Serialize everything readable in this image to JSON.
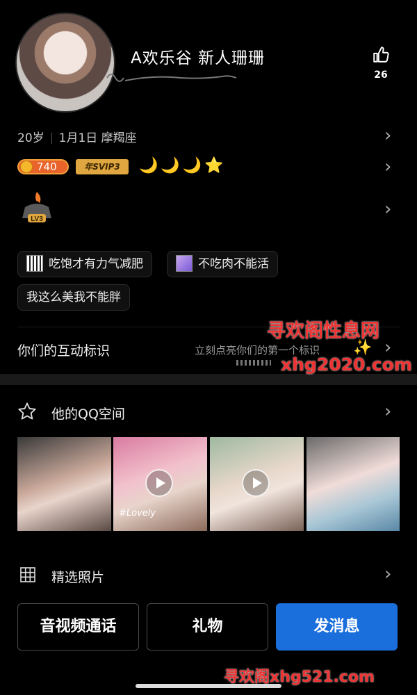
{
  "profile": {
    "name": "A欢乐谷 新人珊珊",
    "like_count": "26",
    "age": "20岁",
    "birthday": "1月1日 摩羯座",
    "gold_level": "740",
    "svip_label": "年SVIP3",
    "moons": "🌙🌙🌙⭐",
    "lv_label": "LV3"
  },
  "tags": [
    {
      "label": "吃饱才有力气减肥"
    },
    {
      "label": "不吃肉不能活"
    },
    {
      "label": "我这么美我不能胖"
    }
  ],
  "interaction": {
    "title": "你们的互动标识",
    "hint": "立刻点亮你们的第一个标识"
  },
  "qzone": {
    "title": "他的QQ空间",
    "photos": [
      {
        "type": "photo",
        "caption": ""
      },
      {
        "type": "video",
        "caption": "#Lovely"
      },
      {
        "type": "video",
        "caption": ""
      },
      {
        "type": "photo",
        "caption": ""
      }
    ]
  },
  "featured": {
    "title": "精选照片"
  },
  "actions": {
    "call": "音视频通话",
    "gift": "礼物",
    "message": "发消息"
  },
  "watermarks": {
    "site_name": "寻欢阁性息网",
    "site_url": "xhg2020.com",
    "bottom": "寻欢阁xhg521.com"
  },
  "colors": {
    "primary": "#1a6fdc",
    "background": "#000000"
  }
}
